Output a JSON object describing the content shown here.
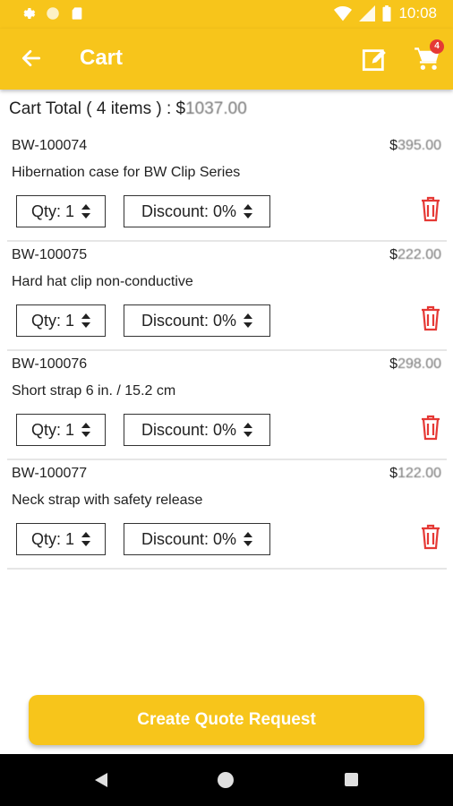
{
  "status_bar": {
    "time": "10:08"
  },
  "app_bar": {
    "title": "Cart",
    "cart_badge_count": "4"
  },
  "cart_total": {
    "label": "Cart Total ( 4 items ) : $",
    "amount": "1037.00"
  },
  "items": [
    {
      "sku": "BW-100074",
      "price_prefix": "$",
      "price_amount": "395.00",
      "description": "Hibernation case for BW Clip Series",
      "qty": "Qty: 1",
      "discount": "Discount: 0%"
    },
    {
      "sku": "BW-100075",
      "price_prefix": "$",
      "price_amount": "222.00",
      "description": "Hard hat clip non-conductive",
      "qty": "Qty: 1",
      "discount": "Discount: 0%"
    },
    {
      "sku": "BW-100076",
      "price_prefix": "$",
      "price_amount": "298.00",
      "description": "Short strap 6 in. / 15.2 cm",
      "qty": "Qty: 1",
      "discount": "Discount: 0%"
    },
    {
      "sku": "BW-100077",
      "price_prefix": "$",
      "price_amount": "122.00",
      "description": "Neck strap with safety release",
      "qty": "Qty: 1",
      "discount": "Discount: 0%"
    }
  ],
  "cta": {
    "label": "Create Quote Request"
  },
  "colors": {
    "accent": "#f7c51b",
    "danger": "#e53935"
  },
  "icons": [
    "settings-icon",
    "circle-icon",
    "sd-card-icon",
    "wifi-icon",
    "signal-icon",
    "battery-icon",
    "back-arrow-icon",
    "edit-icon",
    "cart-icon",
    "trash-icon",
    "nav-back-icon",
    "nav-home-icon",
    "nav-recents-icon"
  ]
}
